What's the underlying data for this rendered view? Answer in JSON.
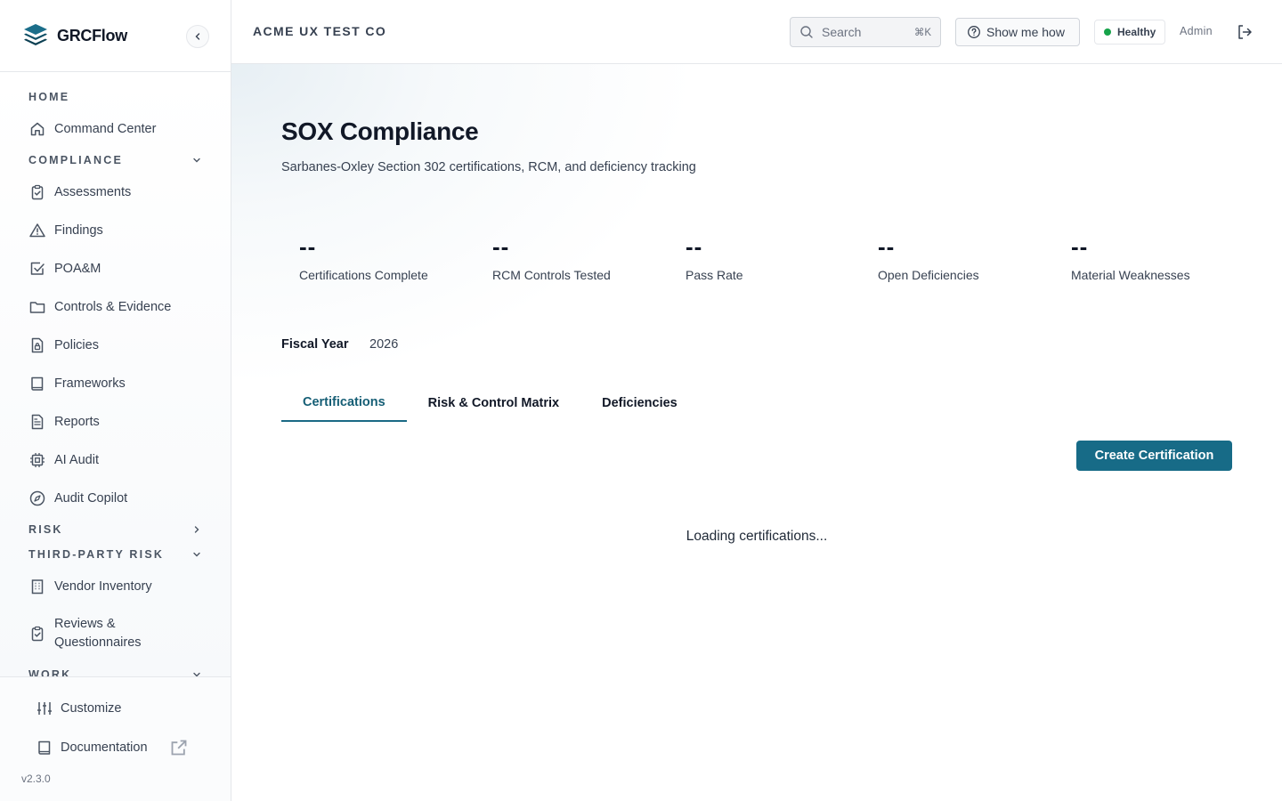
{
  "brand": {
    "name": "GRCFlow"
  },
  "header": {
    "org_name": "ACME UX TEST CO",
    "search_placeholder": "Search",
    "search_shortcut": "⌘K",
    "show_me_how": "Show me how",
    "health_status": "Healthy",
    "health_color": "#16a34a",
    "user_role": "Admin"
  },
  "sidebar": {
    "home_section": "HOME",
    "command_center": "Command Center",
    "compliance_section": "COMPLIANCE",
    "compliance_items": [
      "Assessments",
      "Findings",
      "POA&M",
      "Controls & Evidence",
      "Policies",
      "Frameworks",
      "Reports",
      "AI Audit",
      "Audit Copilot"
    ],
    "risk_section": "RISK",
    "tprm_section": "THIRD-PARTY RISK",
    "tprm_items": [
      "Vendor Inventory",
      "Reviews & Questionnaires"
    ],
    "work_section": "WORK",
    "customize": "Customize",
    "documentation": "Documentation",
    "version": "v2.3.0"
  },
  "page": {
    "title": "SOX Compliance",
    "subtitle": "Sarbanes-Oxley Section 302 certifications, RCM, and deficiency tracking",
    "stats": [
      {
        "value": "--",
        "label": "Certifications Complete"
      },
      {
        "value": "--",
        "label": "RCM Controls Tested"
      },
      {
        "value": "--",
        "label": "Pass Rate"
      },
      {
        "value": "--",
        "label": "Open Deficiencies"
      },
      {
        "value": "--",
        "label": "Material Weaknesses"
      }
    ],
    "fiscal_year_label": "Fiscal Year",
    "fiscal_year_value": "2026",
    "tabs": [
      "Certifications",
      "Risk & Control Matrix",
      "Deficiencies"
    ],
    "active_tab": "Certifications",
    "create_button": "Create Certification",
    "loading_text": "Loading certifications...",
    "accent_color": "#176b87"
  }
}
